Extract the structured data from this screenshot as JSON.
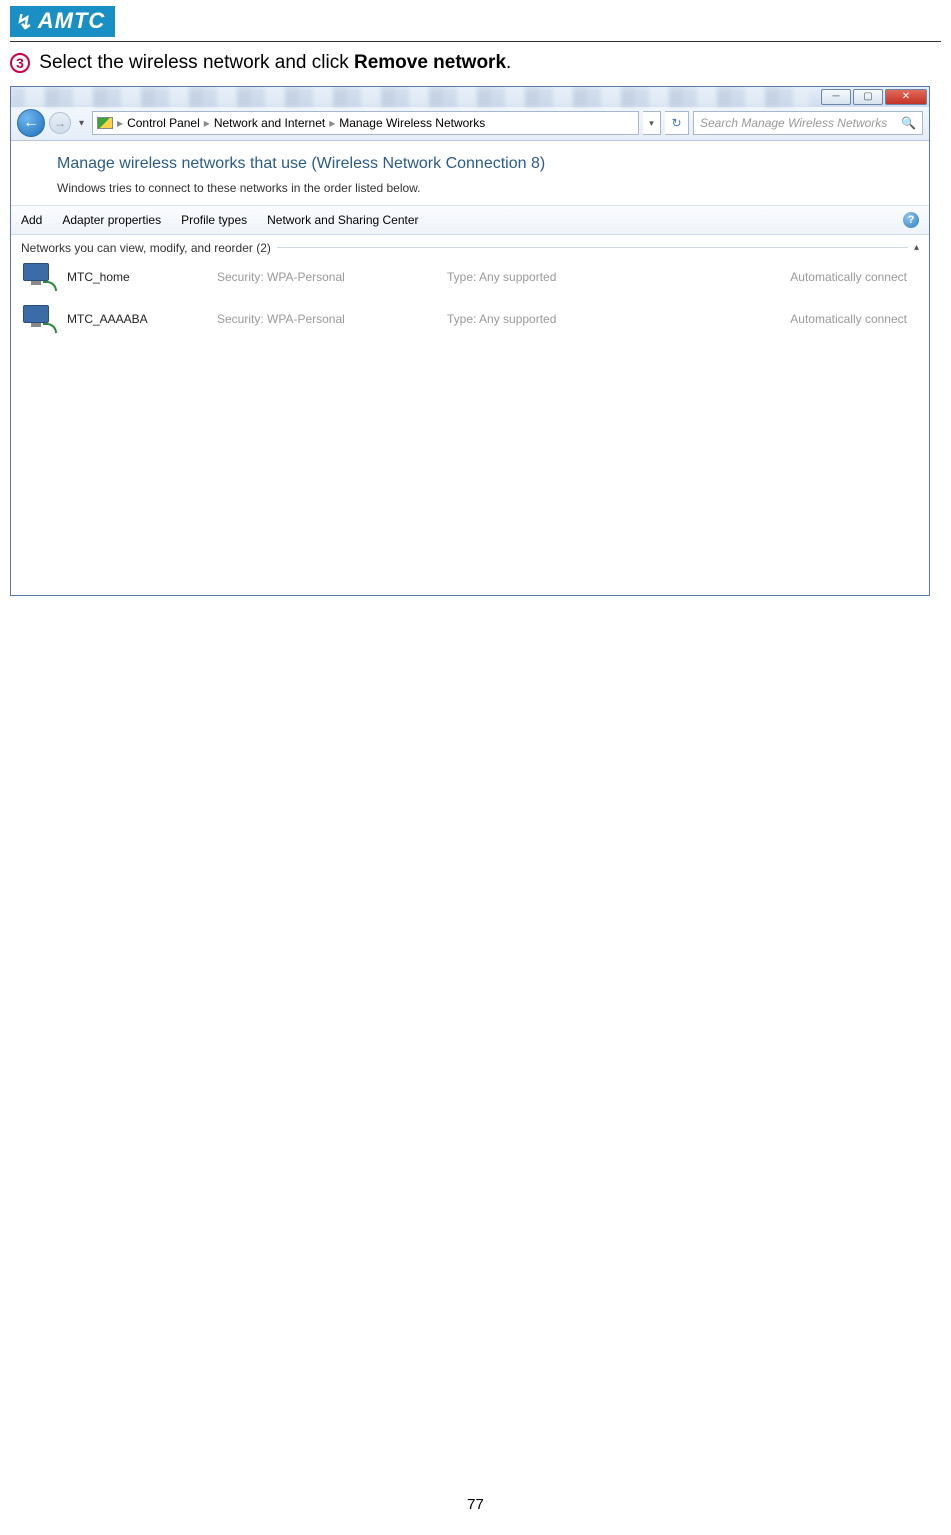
{
  "logo_text": "AMTC",
  "instruction": {
    "num": "3",
    "pre": " Select the wireless network and click ",
    "bold": "Remove network",
    "post": "."
  },
  "window": {
    "breadcrumb": {
      "p1": "Control Panel",
      "p2": "Network and Internet",
      "p3": "Manage Wireless Networks"
    },
    "search_placeholder": "Search Manage Wireless Networks",
    "heading": "Manage wireless networks that use (Wireless Network Connection 8)",
    "subheading": "Windows tries to connect to these networks in the order listed below.",
    "toolbar": {
      "add": "Add",
      "adapter": "Adapter properties",
      "profile": "Profile types",
      "nsc": "Network and Sharing Center"
    },
    "group_label": "Networks you can view, modify, and reorder (2)",
    "rows": [
      {
        "name": "MTC_home",
        "security": "Security:  WPA-Personal",
        "type": "Type:  Any supported",
        "auto": "Automatically connect"
      },
      {
        "name": "MTC_AAAABA",
        "security": "Security:  WPA-Personal",
        "type": "Type:  Any supported",
        "auto": "Automatically connect"
      }
    ]
  },
  "page_number": "77"
}
